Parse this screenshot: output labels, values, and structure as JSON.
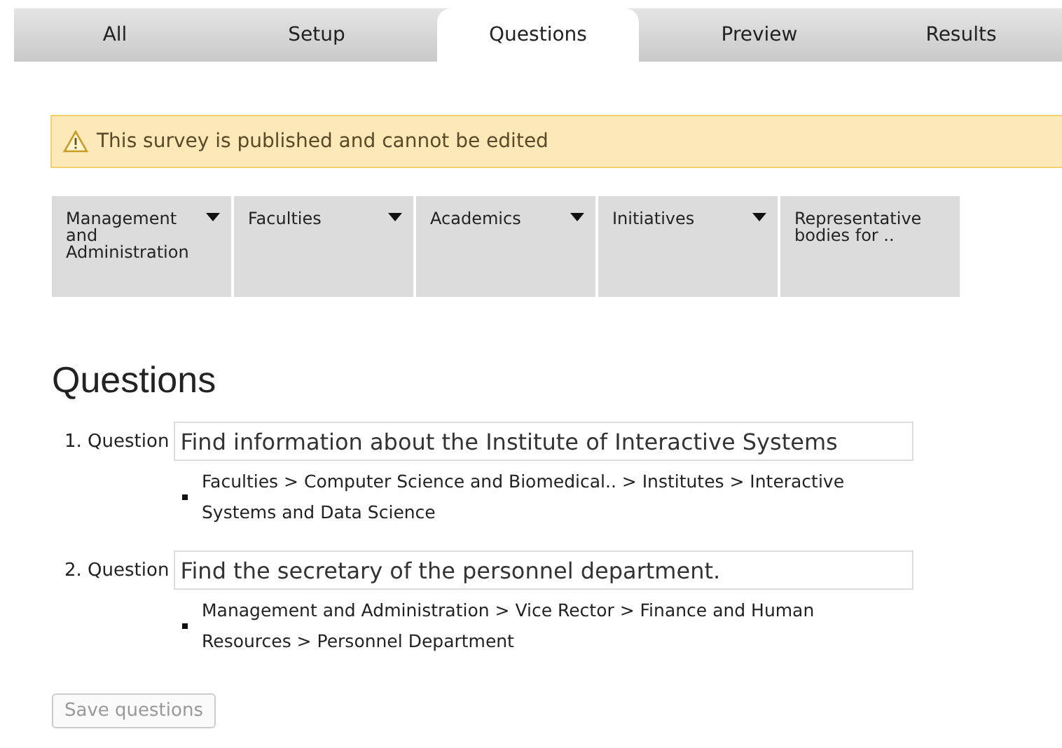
{
  "tabs": [
    {
      "label": "All",
      "selected": false
    },
    {
      "label": "Setup",
      "selected": false
    },
    {
      "label": "Questions",
      "selected": true
    },
    {
      "label": "Preview",
      "selected": false
    },
    {
      "label": "Results",
      "selected": false
    }
  ],
  "alert": {
    "text": "This survey is published and cannot be edited"
  },
  "menu": [
    {
      "label": "Management and Administration",
      "has_dropdown": true
    },
    {
      "label": "Faculties",
      "has_dropdown": true
    },
    {
      "label": "Academics",
      "has_dropdown": true
    },
    {
      "label": "Initiatives",
      "has_dropdown": true
    },
    {
      "label": "Representative bodies for ..",
      "has_dropdown": false
    }
  ],
  "heading": "Questions",
  "questions": [
    {
      "label": "1. Question",
      "value": "Find information about the Institute of Interactive Systems",
      "paths": [
        "Faculties > Computer Science and Biomedical.. > Institutes > Interactive Systems and Data Science"
      ]
    },
    {
      "label": "2. Question",
      "value": "Find the secretary of the personnel department.",
      "paths": [
        "Management and Administration > Vice Rector > Finance and Human Resources > Personnel Department"
      ]
    }
  ],
  "save_button": {
    "label": "Save questions",
    "disabled": true
  }
}
